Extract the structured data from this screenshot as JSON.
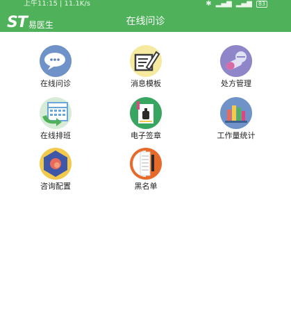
{
  "status_bar": {
    "time_speed": "上午11:15 | 11.1K/s",
    "battery": "83"
  },
  "header": {
    "logo_mark": "ST",
    "logo_text": "易医生",
    "title": "在线问诊"
  },
  "menu": [
    {
      "label": "在线问诊",
      "icon": "chat-bubbles-icon"
    },
    {
      "label": "消息模板",
      "icon": "edit-template-icon"
    },
    {
      "label": "处方管理",
      "icon": "pills-icon"
    },
    {
      "label": "在线排班",
      "icon": "calendar-schedule-icon"
    },
    {
      "label": "电子签章",
      "icon": "seal-stamp-icon"
    },
    {
      "label": "工作量统计",
      "icon": "books-stats-icon"
    },
    {
      "label": "咨询配置",
      "icon": "config-hexagon-icon"
    },
    {
      "label": "黑名单",
      "icon": "blacklist-notebook-icon"
    }
  ],
  "colors": {
    "header_bg": "#4fb15a"
  }
}
